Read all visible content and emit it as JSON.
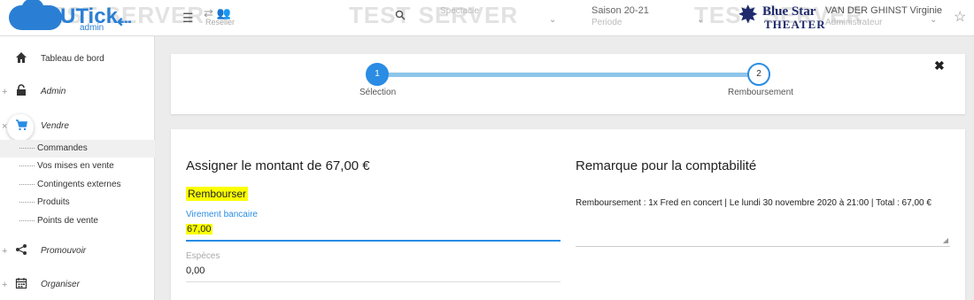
{
  "header": {
    "watermark": "TEST SERVER",
    "logo_brand": "UTick",
    "logo_sub": "admin",
    "menu_icon": "hamburger-icon",
    "reseller_label": "Reseller",
    "spectacle_placeholder": "Spectacle",
    "periode_value": "Saison 20-21",
    "periode_label": "Periode",
    "theater_name_line1": "Blue Star",
    "theater_name_line2": "THEATER",
    "user_name": "VAN DER GHINST Virginie",
    "user_role": "Administrateur"
  },
  "sidebar": {
    "items": [
      {
        "label": "Tableau de bord",
        "icon": "home-icon"
      },
      {
        "label": "Admin",
        "icon": "lock-icon"
      },
      {
        "label": "Vendre",
        "icon": "cart-icon"
      },
      {
        "label": "Promouvoir",
        "icon": "share-icon"
      },
      {
        "label": "Organiser",
        "icon": "calendar-icon"
      }
    ],
    "sub_items": [
      "Commandes",
      "Vos mises en vente",
      "Contingents externes",
      "Produits",
      "Points de vente"
    ]
  },
  "stepper": {
    "step1_number": "1",
    "step1_label": "Sélection",
    "step2_number": "2",
    "step2_label": "Remboursement"
  },
  "form": {
    "title": "Assigner le montant de 67,00 €",
    "subtitle": "Rembourser",
    "field1_label": "Virement bancaire",
    "field1_value": "67,00",
    "field2_label": "Espèces",
    "field2_value": "0,00",
    "remark_title": "Remarque pour la comptabilité",
    "remark_text": "Remboursement : 1x  Fred en concert | Le lundi 30 novembre 2020 à 21:00 | Total : 67,00 €"
  },
  "colors": {
    "accent": "#2a8ce3",
    "highlight": "#fbff00",
    "brand": "#2a7fd4",
    "theater": "#1e2a6b"
  }
}
